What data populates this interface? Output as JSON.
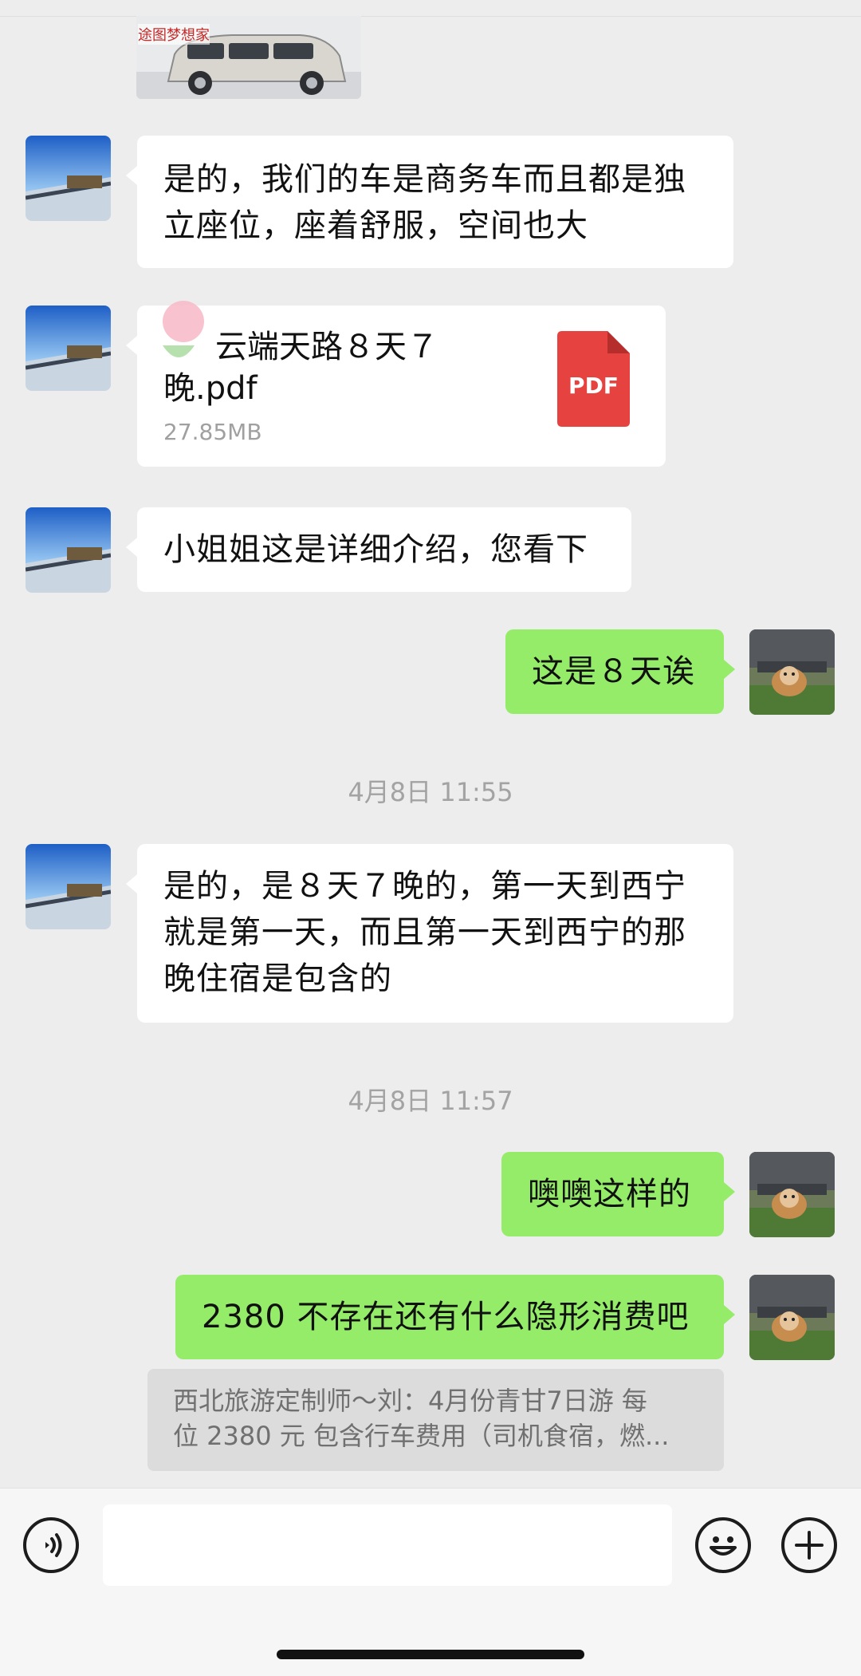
{
  "image_card": {
    "watermark": "途图梦想家"
  },
  "messages": [
    {
      "sender": "them",
      "text_lines": [
        "是的，我们的车是商务车而且都是独",
        "立座位，座着舒服，空间也大"
      ]
    },
    {
      "sender": "them",
      "type": "file",
      "file_name": "云端天路８天７晚.pdf",
      "file_name_lines": [
        "云端天路８天７",
        "晚.pdf"
      ],
      "file_size": "27.85MB",
      "file_type": "PDF"
    },
    {
      "sender": "them",
      "text": "小姐姐这是详细介绍，您看下"
    },
    {
      "sender": "me",
      "text": "这是８天诶"
    },
    {
      "sender": "them",
      "text_lines": [
        "是的，是８天７晚的，第一天到西宁",
        "就是第一天，而且第一天到西宁的那",
        "晚住宿是包含的"
      ]
    },
    {
      "sender": "me",
      "text": "噢噢这样的"
    },
    {
      "sender": "me",
      "text": "2380 不存在还有什么隐形消费吧"
    }
  ],
  "timestamps": [
    "4月8日 11:55",
    "4月8日 11:57"
  ],
  "quote": {
    "lines": [
      "西北旅游定制师～刘：4月份青甘7日游 每",
      "位 2380 元 包含行车费用（司机食宿，燃..."
    ]
  },
  "input_bar": {
    "placeholder": "",
    "voice_icon": "voice-icon",
    "emoji_icon": "emoji-icon",
    "plus_icon": "plus-icon"
  },
  "colors": {
    "background": "#ededed",
    "my_bubble": "#95ec69",
    "their_bubble": "#ffffff",
    "pdf_red": "#e64340"
  }
}
